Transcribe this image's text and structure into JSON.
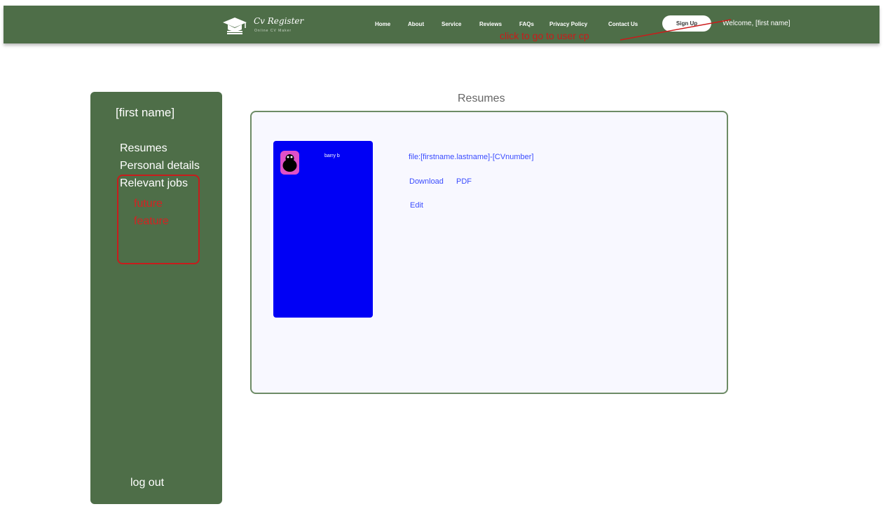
{
  "header": {
    "logo_title": "Cv Register",
    "logo_subtitle": "Online CV Maker",
    "logo_icon": "graduation-cap-icon",
    "nav": [
      "Home",
      "About",
      "Service",
      "Reviews",
      "FAQs",
      "Privacy Policy",
      "Contact Us"
    ],
    "signup_label": "Sign Up",
    "welcome": "Welcome, [first name]",
    "annotation": "click to go to user cp"
  },
  "sidebar": {
    "name": "[first name]",
    "items": [
      "Resumes",
      "Personal details",
      "Relevant jobs"
    ],
    "future_line1": "future",
    "future_line2": "feature",
    "logout": "log out"
  },
  "main": {
    "title": "Resumes",
    "card_name": "barry b",
    "file_label": "file:[firstname.lastname]-[CVnumber]",
    "download_label": "Download",
    "pdf_label": "PDF",
    "edit_label": "Edit"
  },
  "colors": {
    "header_green": "#4e6e48",
    "card_blue": "#0000f5",
    "link_blue": "#3a4cff",
    "annotation_red": "#cc1a1a"
  }
}
